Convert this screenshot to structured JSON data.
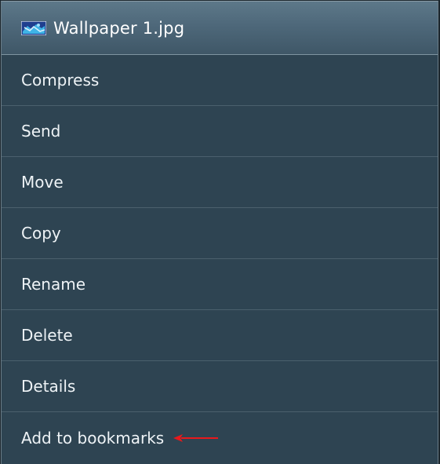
{
  "dialog": {
    "title": "Wallpaper 1.jpg",
    "thumbnail_icon": "image-thumbnail-icon",
    "items": [
      {
        "label": "Compress"
      },
      {
        "label": "Send"
      },
      {
        "label": "Move"
      },
      {
        "label": "Copy"
      },
      {
        "label": "Rename"
      },
      {
        "label": "Delete"
      },
      {
        "label": "Details"
      },
      {
        "label": "Add to bookmarks"
      }
    ]
  },
  "annotation": {
    "icon": "red-arrow-icon",
    "color": "#e8191c"
  },
  "colors": {
    "menu_background": "#2e4452",
    "header_gradient_top": "#5d7889",
    "divider": "#4b606d",
    "text": "#eef3f6"
  }
}
